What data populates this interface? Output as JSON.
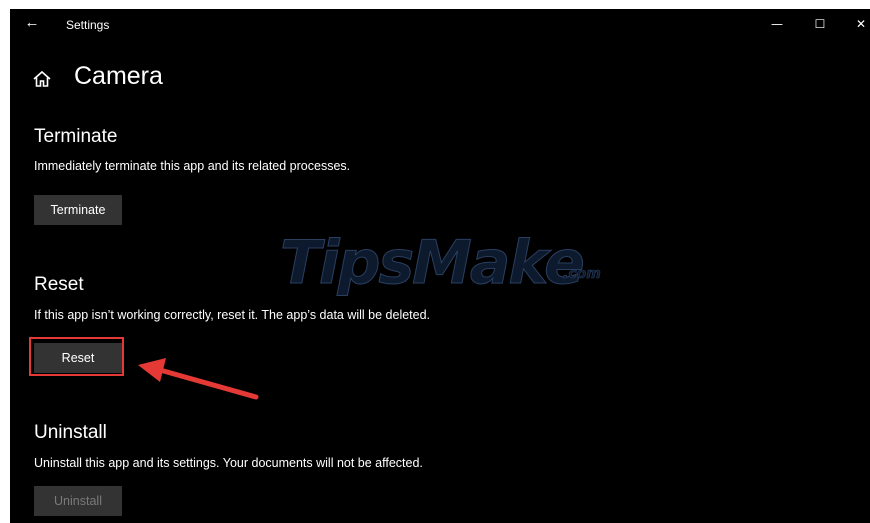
{
  "window": {
    "title": "Settings",
    "back_icon": "arrow-left-icon",
    "controls": {
      "minimize_glyph": "—",
      "maximize_glyph": "☐",
      "close_glyph": "✕"
    }
  },
  "header": {
    "icon": "home-icon",
    "title": "Camera"
  },
  "terminate": {
    "title": "Terminate",
    "description": "Immediately terminate this app and its related processes.",
    "button_label": "Terminate"
  },
  "reset": {
    "title": "Reset",
    "description": "If this app isn’t working correctly, reset it. The app’s data will be deleted.",
    "button_label": "Reset",
    "highlight_color": "#e53935"
  },
  "uninstall": {
    "title": "Uninstall",
    "description": "Uninstall this app and its settings. Your documents will not be affected.",
    "button_label": "Uninstall",
    "button_disabled": true
  },
  "watermark": {
    "text": "TipsMake",
    "domain": ".com"
  },
  "colors": {
    "background": "#000000",
    "button": "#333333",
    "annotation": "#e53935"
  }
}
